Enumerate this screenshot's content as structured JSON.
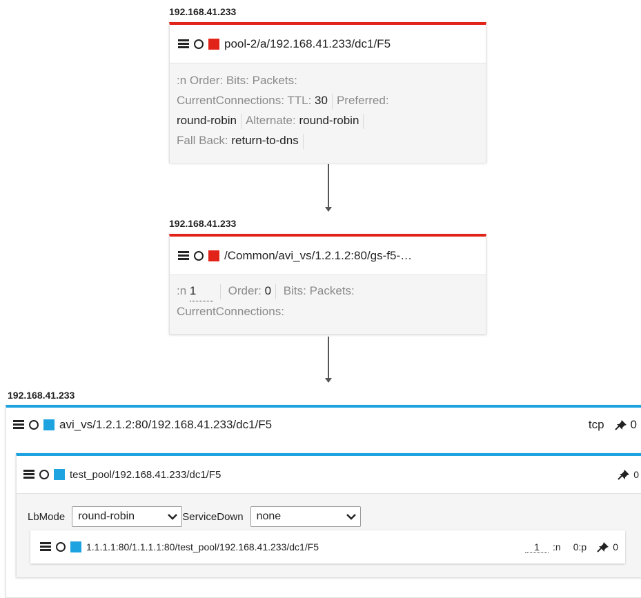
{
  "node1": {
    "host": "192.168.41.233",
    "name": "pool-2/a/192.168.41.233/dc1/F5",
    "status_color": "#e2231a",
    "lbl_n": ":n",
    "lbl_order": "Order:",
    "lbl_bits": "Bits:",
    "lbl_packets": "Packets:",
    "lbl_current": "CurrentConnections:",
    "lbl_ttl": "TTL:",
    "ttl": "30",
    "lbl_preferred": "Preferred:",
    "preferred": "round-robin",
    "lbl_alternate": "Alternate:",
    "alternate": "round-robin",
    "lbl_fallback": "Fall Back:",
    "fallback": "return-to-dns"
  },
  "node2": {
    "host": "192.168.41.233",
    "name": "/Common/avi_vs/1.2.1.2:80/gs-f5-…",
    "status_color": "#e2231a",
    "lbl_n": ":n",
    "n_value": "1",
    "lbl_order": "Order:",
    "order": "0",
    "lbl_bits": "Bits:",
    "lbl_packets": "Packets:",
    "lbl_current": "CurrentConnections:"
  },
  "node3": {
    "host": "192.168.41.233",
    "name": "avi_vs/1.2.1.2:80/192.168.41.233/dc1/F5",
    "status_color": "#1ea3e1",
    "protocol": "tcp",
    "pin_count": "0",
    "pool": {
      "name": "test_pool/192.168.41.233/dc1/F5",
      "pin_count": "0",
      "lbmode_label": "LbMode",
      "lbmode_value": "round-robin",
      "servicedown_label": "ServiceDown",
      "servicedown_value": "none",
      "member": {
        "name": "1.1.1.1:80/1.1.1.1:80/test_pool/192.168.41.233/dc1/F5",
        "n_value": "1",
        "lbl_n": ":n",
        "p_text": "0:p",
        "pin_count": "0"
      }
    }
  },
  "icons": [
    "list-icon",
    "status-circle-icon",
    "status-square-icon",
    "pin-icon",
    "chevron-down-icon"
  ]
}
